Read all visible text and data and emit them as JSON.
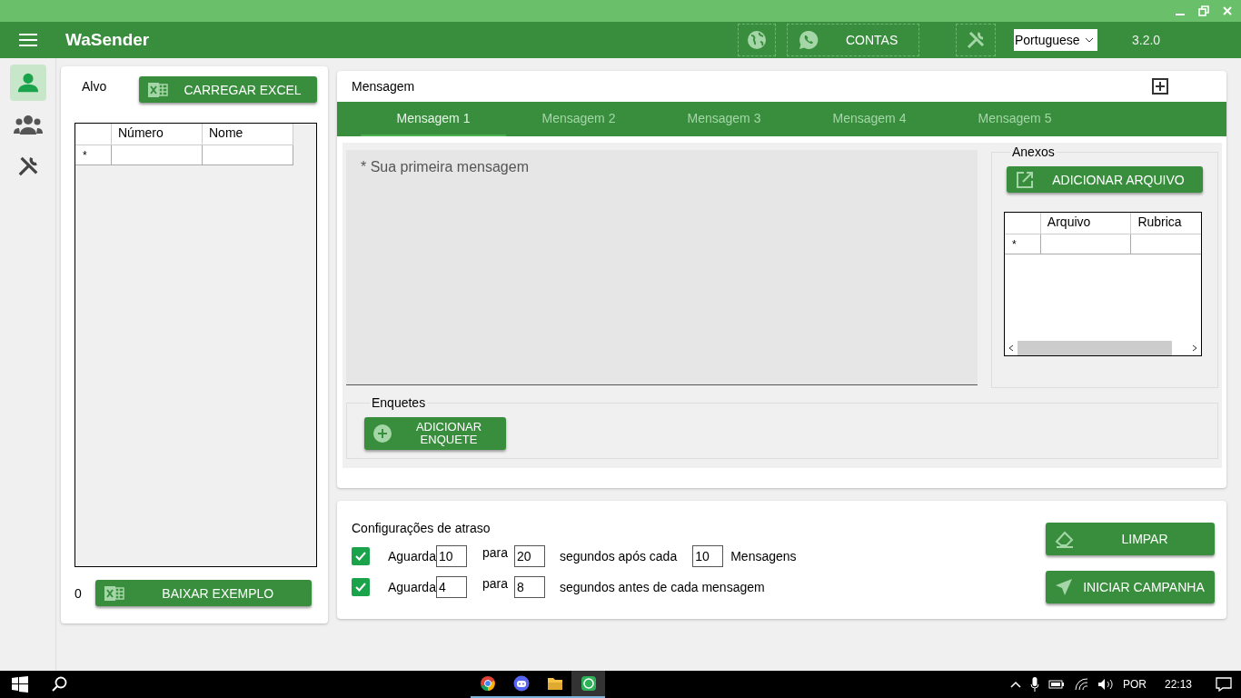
{
  "header": {
    "app_title": "WaSender",
    "accounts_button": "CONTAS",
    "language": "Portuguese",
    "version": "3.2.0"
  },
  "sidebar": {
    "items": [
      {
        "kind": "person",
        "selected": true
      },
      {
        "kind": "group",
        "selected": false
      },
      {
        "kind": "tools",
        "selected": false
      }
    ]
  },
  "target_panel": {
    "label": "Alvo",
    "load_button": "CARREGAR EXCEL",
    "table": {
      "columns": [
        "Número",
        "Nome"
      ],
      "new_row_marker": "*"
    },
    "count": "0",
    "example_button": "BAIXAR EXEMPLO"
  },
  "message_panel": {
    "title": "Mensagem",
    "tabs": [
      {
        "label": "Mensagem 1",
        "selected": true
      },
      {
        "label": "Mensagem 2",
        "selected": false
      },
      {
        "label": "Mensagem 3",
        "selected": false
      },
      {
        "label": "Mensagem 4",
        "selected": false
      },
      {
        "label": "Mensagem 5",
        "selected": false
      }
    ],
    "message": {
      "placeholder": "* Sua primeira mensagem"
    },
    "attachments": {
      "legend": "Anexos",
      "button": "ADICIONAR ARQUIVO",
      "table": {
        "columns": [
          "Arquivo",
          "Rubrica"
        ],
        "new_row_marker": "*"
      }
    },
    "polls": {
      "legend": "Enquetes",
      "button": "ADICIONAR ENQUETE"
    }
  },
  "delay_panel": {
    "title": "Configurações de atraso",
    "rows": [
      {
        "checked": true,
        "wait_label": "Aguarda",
        "min": "10",
        "to_label": "para",
        "max": "20",
        "text": "segundos após cada",
        "count": "10",
        "count_label": "Mensagens"
      },
      {
        "checked": true,
        "wait_label": "Aguarda",
        "min": "4",
        "to_label": "para",
        "max": "8",
        "text": "segundos antes de cada mensagem"
      }
    ],
    "clear_button": "LIMPAR",
    "start_button": "INICIAR CAMPANHA"
  },
  "taskbar": {
    "apps": [
      {
        "kind": "chrome",
        "selected": false
      },
      {
        "kind": "chat",
        "selected": false
      },
      {
        "kind": "folder",
        "selected": false
      },
      {
        "kind": "wasender",
        "selected": true
      }
    ],
    "language": "POR",
    "time": "22:13"
  }
}
